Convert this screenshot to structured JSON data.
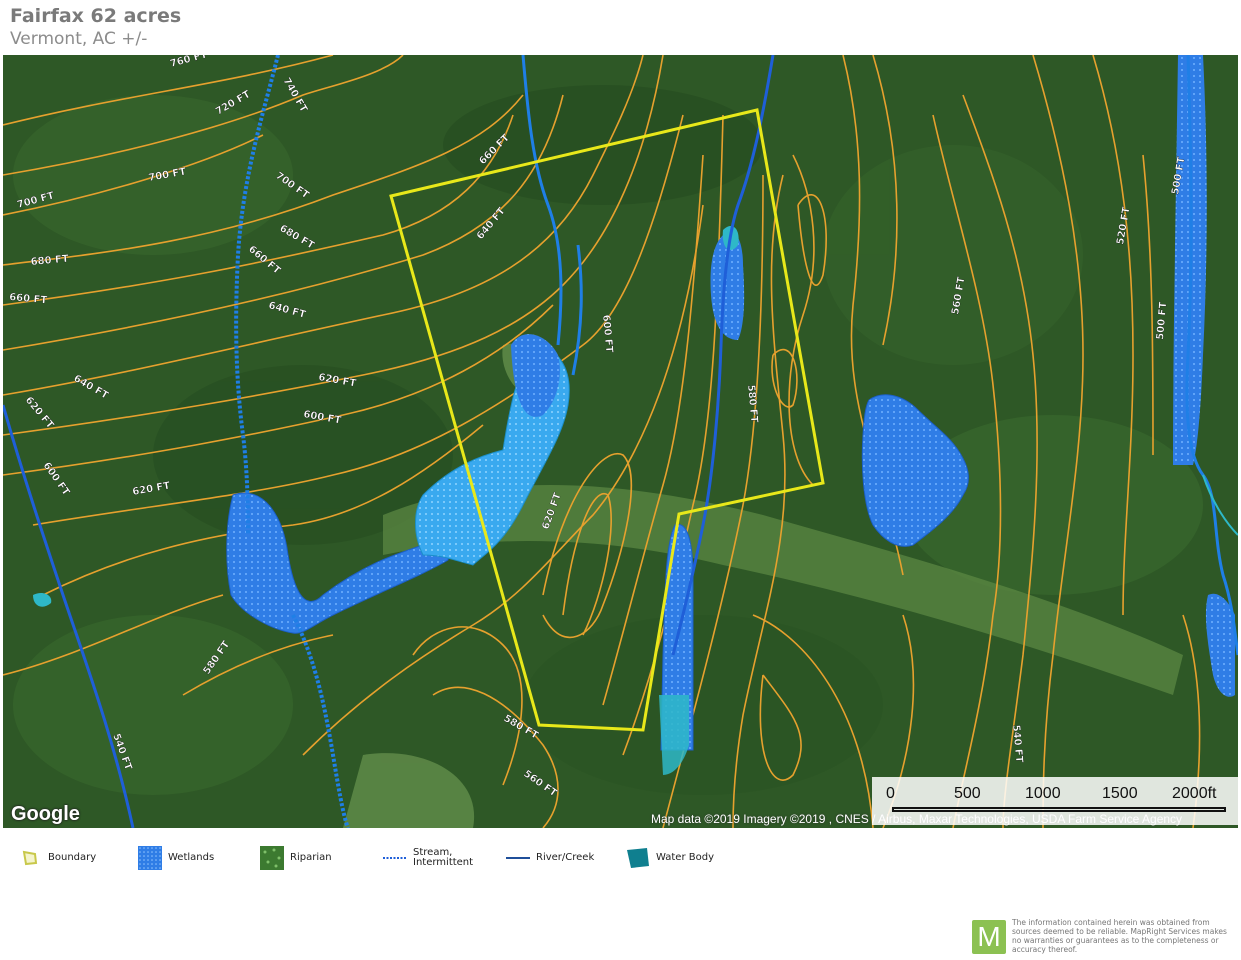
{
  "header": {
    "title": "Fairfax 62 acres",
    "subtitle": "Vermont,  AC +/-"
  },
  "map": {
    "attribution": "Map data ©2019  Imagery ©2019 , CNES / Airbus, Maxar Technologies, USDA Farm Service Agency",
    "google_logo": "Google",
    "contour_labels": [
      "760 FT",
      "740 FT",
      "720 FT",
      "700 FT",
      "700 FT",
      "700 FT",
      "680 FT",
      "680 FT",
      "660 FT",
      "660 FT",
      "640 FT",
      "640 FT",
      "620 FT",
      "620 FT",
      "600 FT",
      "600 FT",
      "620 FT",
      "580 FT",
      "580 FT",
      "560 FT",
      "540 FT",
      "520 FT",
      "500 FT",
      "500 FT",
      "660 FT",
      "640 FT",
      "620 FT",
      "600 FT",
      "580 FT",
      "560 FT",
      "540 FT"
    ],
    "scalebar": {
      "labels": [
        "0",
        "500",
        "1000",
        "1500",
        "2000ft"
      ]
    },
    "colors": {
      "boundary": "#e8e81a",
      "contour": "#e6a12e",
      "wetland": "#2f7de6",
      "water_body": "#2eb8c8",
      "river": "#1f5fd8"
    }
  },
  "legend": {
    "items": [
      {
        "label_line1": "Boundary",
        "label_line2": "",
        "icon": "boundary-icon"
      },
      {
        "label_line1": "Wetlands",
        "label_line2": "",
        "icon": "wetlands-icon"
      },
      {
        "label_line1": "Riparian",
        "label_line2": "",
        "icon": "riparian-icon"
      },
      {
        "label_line1": "Stream,",
        "label_line2": "Intermittent",
        "icon": "stream-icon"
      },
      {
        "label_line1": "River/Creek",
        "label_line2": "",
        "icon": "river-icon"
      },
      {
        "label_line1": "Water Body",
        "label_line2": "",
        "icon": "water-body-icon"
      }
    ]
  },
  "disclaimer": {
    "logo_letter": "M",
    "text": "The information contained herein was obtained from sources deemed to be reliable. MapRight Services makes no warranties or guarantees as to the completeness or accuracy thereof."
  }
}
